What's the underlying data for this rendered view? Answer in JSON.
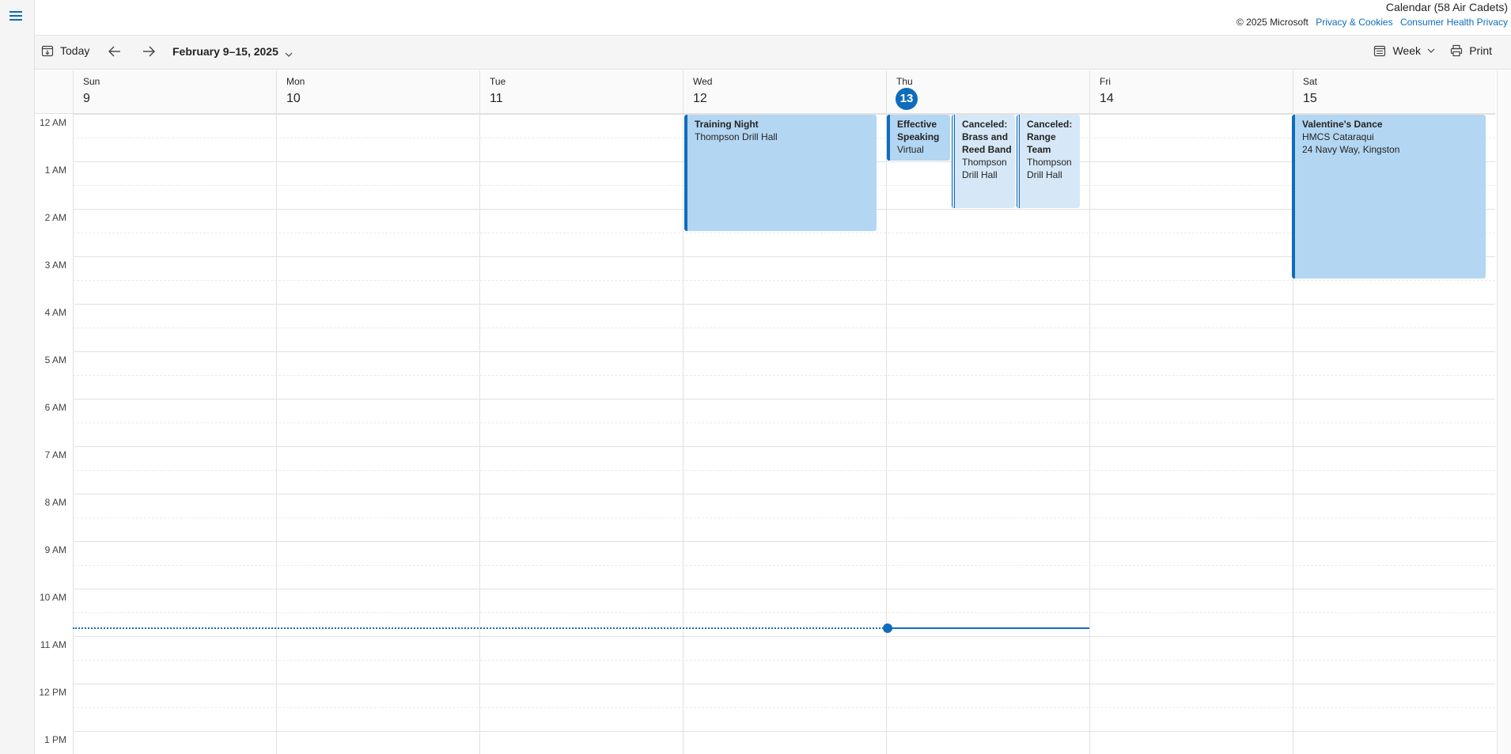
{
  "app_title": "Calendar (58 Air Cadets)",
  "footer_links": {
    "copyright": "© 2025 Microsoft",
    "privacy": "Privacy & Cookies",
    "health_privacy": "Consumer Health Privacy"
  },
  "toolbar": {
    "today_label": "Today",
    "date_range": "February 9–15, 2025",
    "view_label": "Week",
    "print_label": "Print"
  },
  "days": [
    {
      "name": "Sun",
      "date": "9"
    },
    {
      "name": "Mon",
      "date": "10"
    },
    {
      "name": "Tue",
      "date": "11"
    },
    {
      "name": "Wed",
      "date": "12"
    },
    {
      "name": "Thu",
      "date": "13"
    },
    {
      "name": "Fri",
      "date": "14"
    },
    {
      "name": "Sat",
      "date": "15"
    }
  ],
  "today_index": 4,
  "hours": [
    "12 AM",
    "1 AM",
    "2 AM",
    "3 AM",
    "4 AM",
    "5 AM",
    "6 AM",
    "7 AM",
    "8 AM",
    "9 AM",
    "10 AM",
    "11 AM",
    "12 PM",
    "1 PM"
  ],
  "events": [
    {
      "title": "Training Night",
      "location": "Thompson Drill Hall",
      "extra": "",
      "canceled": false
    },
    {
      "title": "Effective Speaking",
      "location": "Virtual",
      "extra": "",
      "canceled": false
    },
    {
      "title": "Canceled: Brass and Reed Band",
      "location": "Thompson Drill Hall",
      "extra": "",
      "canceled": true
    },
    {
      "title": "Canceled: Range Team",
      "location": "Thompson Drill Hall",
      "extra": "",
      "canceled": true
    },
    {
      "title": "Valentine's Dance",
      "location": "HMCS Cataraqui",
      "extra": "24 Navy Way, Kingston",
      "canceled": false
    }
  ],
  "colors": {
    "accent": "#0f6cbd",
    "event_fill": "#b3d6f2",
    "canceled_fill": "#d6e8f7"
  },
  "icons": [
    "menu-icon",
    "calendar-today-icon",
    "arrow-left-icon",
    "arrow-right-icon",
    "chevron-down-icon",
    "calendar-view-icon",
    "printer-icon"
  ]
}
